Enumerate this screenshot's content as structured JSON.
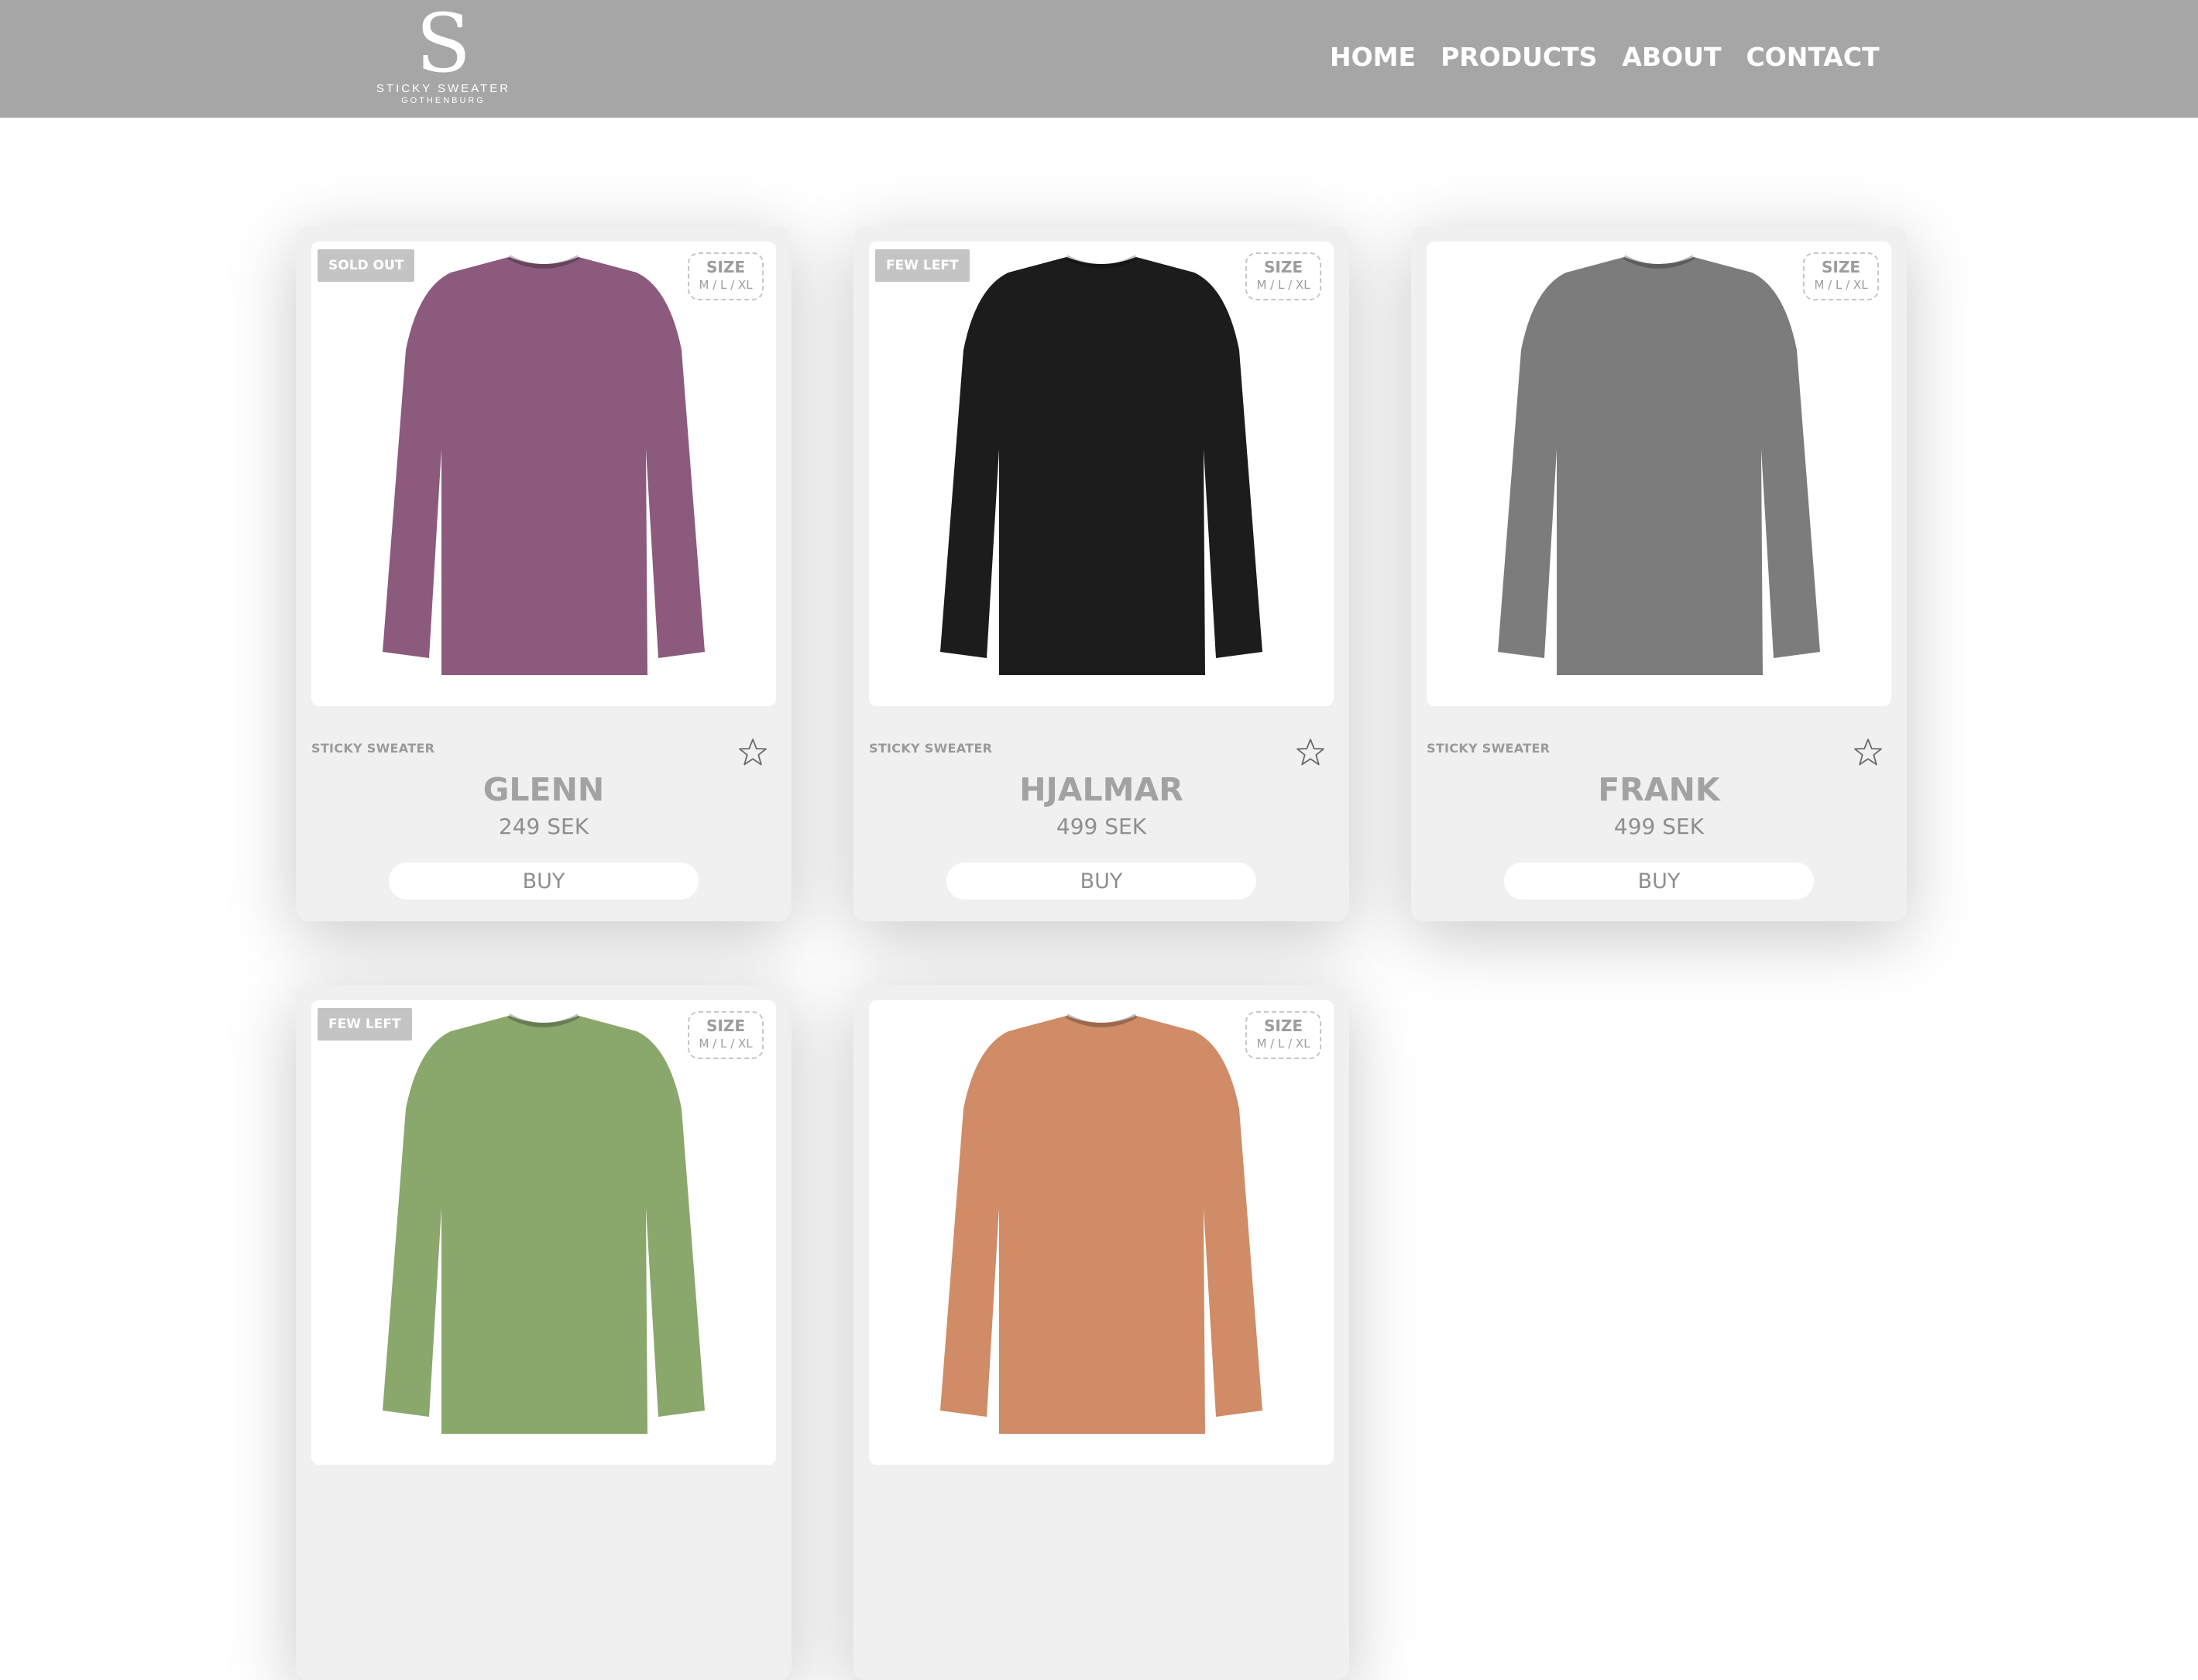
{
  "header": {
    "logo": {
      "letter": "S",
      "name": "STICKY SWEATER",
      "city": "GOTHENBURG"
    },
    "nav": [
      "HOME",
      "PRODUCTS",
      "ABOUT",
      "CONTACT"
    ]
  },
  "products": [
    {
      "stock": "SOLD OUT",
      "size_title": "SIZE",
      "sizes": "M / L / XL",
      "brand": "STICKY SWEATER",
      "name": "GLENN",
      "price": "249 SEK",
      "buy": "BUY",
      "color": "#8b5a7d"
    },
    {
      "stock": "FEW LEFT",
      "size_title": "SIZE",
      "sizes": "M / L / XL",
      "brand": "STICKY SWEATER",
      "name": "HJALMAR",
      "price": "499 SEK",
      "buy": "BUY",
      "color": "#1c1c1c"
    },
    {
      "stock": "",
      "size_title": "SIZE",
      "sizes": "M / L / XL",
      "brand": "STICKY SWEATER",
      "name": "FRANK",
      "price": "499 SEK",
      "buy": "BUY",
      "color": "#7c7c7c"
    },
    {
      "stock": "FEW LEFT",
      "size_title": "SIZE",
      "sizes": "M / L / XL",
      "color": "#8aa76c"
    },
    {
      "stock": "",
      "size_title": "SIZE",
      "sizes": "M / L / XL",
      "color": "#cf8c66"
    }
  ]
}
